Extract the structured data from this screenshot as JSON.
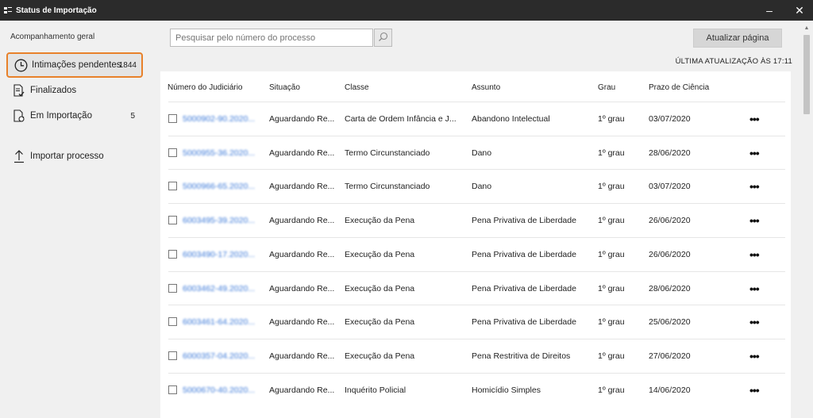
{
  "window": {
    "title": "Status de Importação",
    "minimize": "–",
    "close": "✕"
  },
  "sidebar": {
    "heading": "Acompanhamento geral",
    "items": [
      {
        "label": "Intimações pendentes",
        "count": "1844",
        "icon": "clock-icon"
      },
      {
        "label": "Finalizados",
        "count": "",
        "icon": "document-check-icon"
      },
      {
        "label": "Em Importação",
        "count": "5",
        "icon": "document-refresh-icon"
      },
      {
        "label": "Importar processo",
        "count": "",
        "icon": "upload-arrow-icon"
      }
    ]
  },
  "search": {
    "placeholder": "Pesquisar pelo número do processo"
  },
  "toolbar": {
    "refresh_label": "Atualizar página",
    "last_update": "ÚLTIMA ATUALIZAÇÃO ÀS 17:11"
  },
  "table": {
    "columns": [
      "Número do Judiciário",
      "Situação",
      "Classe",
      "Assunto",
      "Grau",
      "Prazo de Ciência"
    ],
    "rows": [
      {
        "numero": "5000902-90.2020...",
        "situacao": "Aguardando Re...",
        "classe": "Carta de Ordem Infância e J...",
        "assunto": "Abandono Intelectual",
        "grau": "1º grau",
        "prazo": "03/07/2020",
        "more": "•••"
      },
      {
        "numero": "5000955-36.2020...",
        "situacao": "Aguardando Re...",
        "classe": "Termo Circunstanciado",
        "assunto": "Dano",
        "grau": "1º grau",
        "prazo": "28/06/2020",
        "more": "•••"
      },
      {
        "numero": "5000966-65.2020...",
        "situacao": "Aguardando Re...",
        "classe": "Termo Circunstanciado",
        "assunto": "Dano",
        "grau": "1º grau",
        "prazo": "03/07/2020",
        "more": "•••"
      },
      {
        "numero": "6003495-39.2020...",
        "situacao": "Aguardando Re...",
        "classe": "Execução da Pena",
        "assunto": "Pena Privativa de Liberdade",
        "grau": "1º grau",
        "prazo": "26/06/2020",
        "more": "•••"
      },
      {
        "numero": "6003490-17.2020...",
        "situacao": "Aguardando Re...",
        "classe": "Execução da Pena",
        "assunto": "Pena Privativa de Liberdade",
        "grau": "1º grau",
        "prazo": "26/06/2020",
        "more": "•••"
      },
      {
        "numero": "6003462-49.2020...",
        "situacao": "Aguardando Re...",
        "classe": "Execução da Pena",
        "assunto": "Pena Privativa de Liberdade",
        "grau": "1º grau",
        "prazo": "28/06/2020",
        "more": "•••"
      },
      {
        "numero": "6003461-64.2020...",
        "situacao": "Aguardando Re...",
        "classe": "Execução da Pena",
        "assunto": "Pena Privativa de Liberdade",
        "grau": "1º grau",
        "prazo": "25/06/2020",
        "more": "•••"
      },
      {
        "numero": "6000357-04.2020...",
        "situacao": "Aguardando Re...",
        "classe": "Execução da Pena",
        "assunto": "Pena Restritiva de Direitos",
        "grau": "1º grau",
        "prazo": "27/06/2020",
        "more": "•••"
      },
      {
        "numero": "5000670-40.2020...",
        "situacao": "Aguardando Re...",
        "classe": "Inquérito Policial",
        "assunto": "Homicídio Simples",
        "grau": "1º grau",
        "prazo": "14/06/2020",
        "more": "•••"
      }
    ]
  },
  "colors": {
    "active_border": "#e8812a",
    "link": "#3a78d8",
    "titlebar": "#2b2b2b"
  }
}
